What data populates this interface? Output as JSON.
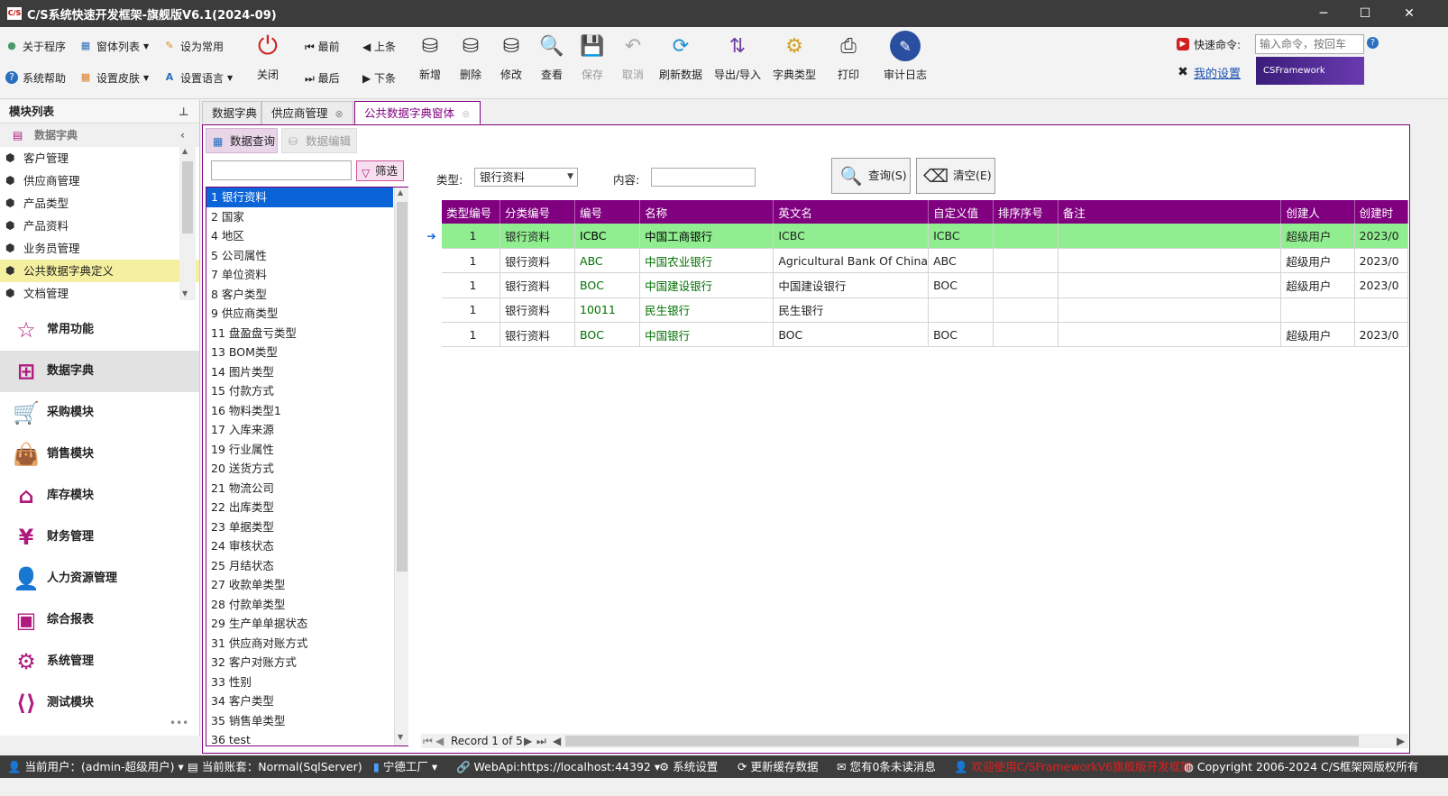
{
  "window": {
    "title": "C/S系统快速开发框架-旗舰版V6.1(2024-09)",
    "logo_text": "C/S",
    "min": "─",
    "max": "☐",
    "close": "✕"
  },
  "ribbon": {
    "small_buttons": {
      "about": "关于程序",
      "window_list": "窗体列表",
      "set_common": "设为常用",
      "help": "系统帮助",
      "skin": "设置皮肤",
      "language": "设置语言"
    },
    "close": "关闭",
    "nav": {
      "first": "最前",
      "prev": "上条",
      "last": "最后",
      "next": "下条"
    },
    "actions": {
      "add": "新增",
      "delete": "删除",
      "edit": "修改",
      "view": "查看",
      "save": "保存",
      "cancel": "取消",
      "refresh": "刷新数据",
      "import_export": "导出/导入",
      "dict_type": "字典类型",
      "print": "打印",
      "audit_log": "审计日志"
    },
    "quick_cmd_label": "快速命令:",
    "quick_cmd_placeholder": "输入命令，按回车",
    "my_settings": "我的设置",
    "brand": "CSFramework"
  },
  "left_panel": {
    "title": "模块列表",
    "pin": "⊥",
    "section": "数据字典",
    "tree": [
      "客户管理",
      "供应商管理",
      "产品类型",
      "产品资料",
      "业务员管理",
      "公共数据字典定义",
      "文档管理"
    ],
    "modules": [
      "常用功能",
      "数据字典",
      "采购模块",
      "销售模块",
      "库存模块",
      "财务管理",
      "人力资源管理",
      "综合报表",
      "系统管理",
      "测试模块"
    ],
    "more": "•••"
  },
  "tabs": [
    {
      "label": "数据字典"
    },
    {
      "label": "供应商管理"
    },
    {
      "label": "公共数据字典窗体"
    }
  ],
  "subtabs": {
    "query": "数据查询",
    "edit": "数据编辑"
  },
  "filter": {
    "button": "筛选",
    "value": ""
  },
  "type_list": [
    "1 银行资料",
    "2 国家",
    "4 地区",
    "5 公司属性",
    "7 单位资料",
    "8 客户类型",
    "9 供应商类型",
    "11 盘盈盘亏类型",
    "13 BOM类型",
    "14 图片类型",
    "15 付款方式",
    "16 物料类型1",
    "17 入库来源",
    "19 行业属性",
    "20 送货方式",
    "21 物流公司",
    "22 出库类型",
    "23 单据类型",
    "24 审核状态",
    "25 月结状态",
    "27 收款单类型",
    "28 付款单类型",
    "29 生产单单据状态",
    "31 供应商对账方式",
    "32 客户对账方式",
    "33 性别",
    "34 客户类型",
    "35 销售单类型",
    "36 test"
  ],
  "search": {
    "type_label": "类型:",
    "type_value": "银行资料",
    "content_label": "内容:",
    "content_value": "",
    "query_btn": "查询(S)",
    "clear_btn": "清空(E)"
  },
  "grid": {
    "columns": [
      "类型编号",
      "分类编号",
      "编号",
      "名称",
      "英文名",
      "自定义值",
      "排序序号",
      "备注",
      "创建人",
      "创建时"
    ],
    "rows": [
      [
        "1",
        "银行资料",
        "ICBC",
        "中国工商银行",
        "ICBC",
        "ICBC",
        "",
        "",
        "超级用户",
        "2023/0"
      ],
      [
        "1",
        "银行资料",
        "ABC",
        "中国农业银行",
        "Agricultural Bank Of China",
        "ABC",
        "",
        "",
        "超级用户",
        "2023/0"
      ],
      [
        "1",
        "银行资料",
        "BOC",
        "中国建设银行",
        "中国建设银行",
        "BOC",
        "",
        "",
        "超级用户",
        "2023/0"
      ],
      [
        "1",
        "银行资料",
        "10011",
        "民生银行",
        "民生银行",
        "",
        "",
        "",
        "",
        ""
      ],
      [
        "1",
        "银行资料",
        "BOC",
        "中国银行",
        "BOC",
        "BOC",
        "",
        "",
        "超级用户",
        "2023/0"
      ]
    ],
    "pager": "Record 1 of 5"
  },
  "statusbar": {
    "user": "当前用户：(admin-超级用户)",
    "account": "当前账套：Normal(SqlServer)",
    "factory": "宁德工厂",
    "webapi": "WebApi:https://localhost:44392",
    "settings": "系统设置",
    "cache": "更新缓存数据",
    "messages": "您有0条未读消息",
    "welcome": "欢迎使用C/SFrameworkV6旗舰版开发框架",
    "copyright": "Copyright 2006-2024 C/S框架网版权所有"
  },
  "colors": {
    "accent": "#800080",
    "selected_row": "#90ee90",
    "list_selected": "#0a64d8",
    "titlebar": "#3c3c3c"
  }
}
